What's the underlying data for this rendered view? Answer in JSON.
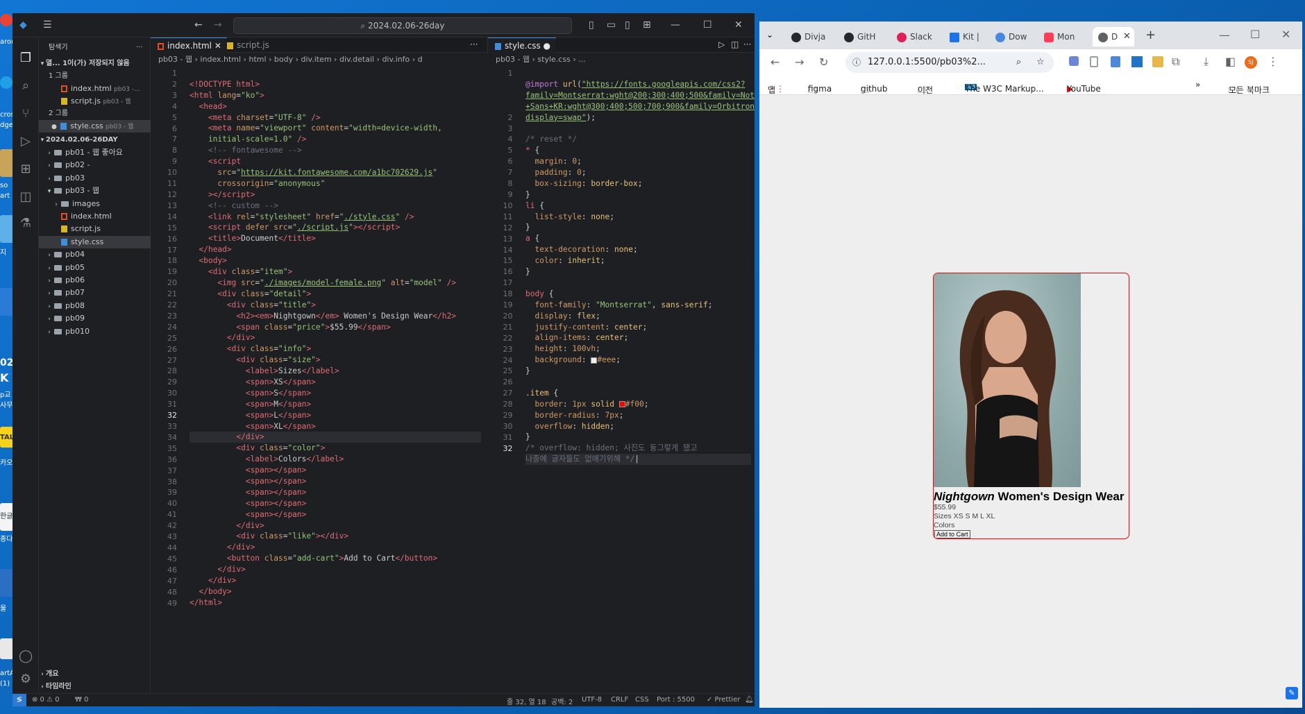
{
  "desktop": {
    "icon_labels": [
      "aron",
      "cros",
      "dge",
      "so",
      "art",
      "지",
      "02",
      "K",
      "p교",
      "사무",
      "TALI",
      "카오",
      "한글",
      "종다",
      "울",
      "artA",
      "(1)"
    ]
  },
  "vscode": {
    "search": "2024.02.06-26day",
    "explorer_title": "탐색기",
    "open_editors": "열... 1이(가) 저장되지 않음",
    "group1": "1 그룹",
    "group1_files": [
      {
        "name": "index.html",
        "path": "pb03 -..."
      },
      {
        "name": "script.js",
        "path": "pb03 - 웹"
      }
    ],
    "group2": "2 그룹",
    "group2_files": [
      {
        "name": "style.css",
        "path": "pb03 - 웹"
      }
    ],
    "workspace": "2024.02.06-26DAY",
    "tree": [
      {
        "label": "pb01 - 웹 좋아요",
        "type": "folder",
        "open": false
      },
      {
        "label": "pb02 -",
        "type": "folder",
        "open": false
      },
      {
        "label": "pb03",
        "type": "folder",
        "open": false
      },
      {
        "label": "pb03 - 웹",
        "type": "folder",
        "open": true
      },
      {
        "label": "images",
        "type": "folder",
        "open": false,
        "indent": 1
      },
      {
        "label": "index.html",
        "type": "html",
        "indent": 1
      },
      {
        "label": "script.js",
        "type": "js",
        "indent": 1
      },
      {
        "label": "style.css",
        "type": "css",
        "indent": 1,
        "selected": true
      },
      {
        "label": "pb04",
        "type": "folder",
        "open": false
      },
      {
        "label": "pb05",
        "type": "folder",
        "open": false
      },
      {
        "label": "pb06",
        "type": "folder",
        "open": false
      },
      {
        "label": "pb07",
        "type": "folder",
        "open": false
      },
      {
        "label": "pb08",
        "type": "folder",
        "open": false
      },
      {
        "label": "pb09",
        "type": "folder",
        "open": false
      },
      {
        "label": "pb010",
        "type": "folder",
        "open": false
      }
    ],
    "outline": "개요",
    "timeline": "타임라인",
    "left_tabs": [
      "index.html",
      "script.js"
    ],
    "right_tab": "style.css",
    "left_crumb": "pb03 - 웹 › index.html › html › body › div.item › div.detail › div.info › d",
    "right_crumb": "pb03 - 웹 › style.css › ...",
    "status": {
      "problems": "⊗ 0 ⚠ 0",
      "ports": "₩ 0",
      "position": "줄 32, 열 18",
      "spaces": "공백: 2",
      "encoding": "UTF-8",
      "eol": "CRLF",
      "lang": "CSS",
      "port": "Port : 5500",
      "prettier": "✓ Prettier"
    }
  },
  "chrome": {
    "tabs": [
      "Divja",
      "GitH",
      "Slack",
      "Kit |",
      "Dow",
      "Mon",
      "D"
    ],
    "url": "127.0.0.1:5500/pb03%2...",
    "bookmarks": [
      "앱",
      "figma",
      "github",
      "이전",
      "The W3C Markup...",
      "YouTube",
      "모든 북마크"
    ]
  },
  "card": {
    "title_em": "Nightgown",
    "title_rest": " Women's Design Wear",
    "price": "$55.99",
    "sizes": "Sizes XS S M L XL",
    "colors": "Colors",
    "button": "Add to Cart"
  }
}
